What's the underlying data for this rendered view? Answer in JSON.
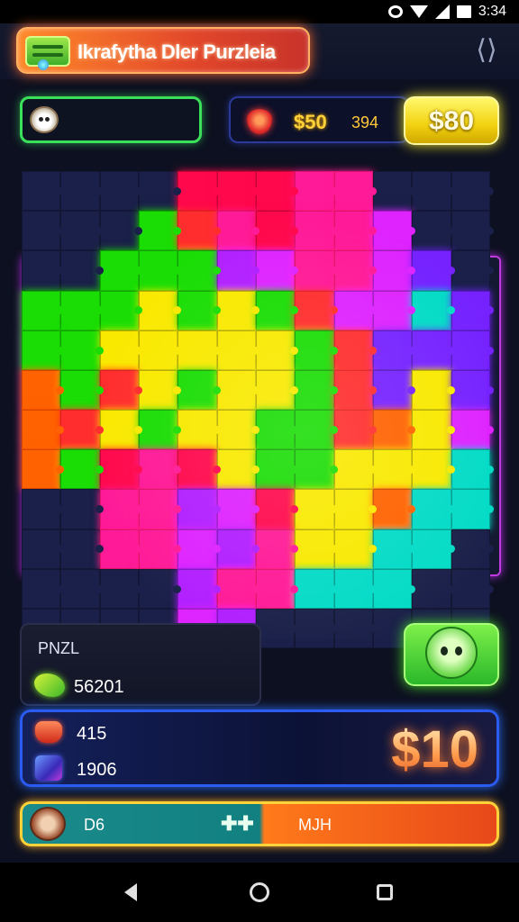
{
  "status_bar": {
    "time": "3:34"
  },
  "header": {
    "title": "Ikrafytha Dler Purzleia",
    "exit_icon": "exit-icon"
  },
  "top_hud": {
    "score_main": "$50",
    "score_sub": "394",
    "coin_button_label": "$80"
  },
  "stats": {
    "label": "PNZL",
    "value": "56201"
  },
  "reward": {
    "ruby_value": "415",
    "cube_value": "1906",
    "price": "$10"
  },
  "bottom_bar": {
    "left_label": "D6",
    "right_label": "MJH"
  },
  "colors": {
    "accent_green": "#3ae05a",
    "accent_orange": "#ff7a1a",
    "accent_blue": "#2b5bf0",
    "accent_yellow": "#ffd23a",
    "board_border": "#c03adf"
  },
  "board": {
    "rows": 12,
    "cols": 12,
    "palette": [
      "#2a1a4a",
      "#1c2040",
      "#e0164a",
      "#ff2a8a",
      "#3ad02a",
      "#f2e62a",
      "#ff6a1a",
      "#9a2ae0",
      "#c030e0",
      "#2ad0c0",
      "#6a2ad8",
      "#ff3a3a"
    ],
    "cells": [
      [
        1,
        1,
        1,
        1,
        2,
        2,
        2,
        3,
        3,
        1,
        1,
        1
      ],
      [
        1,
        1,
        1,
        4,
        11,
        3,
        2,
        3,
        3,
        8,
        1,
        1
      ],
      [
        1,
        1,
        4,
        4,
        4,
        7,
        8,
        3,
        3,
        8,
        10,
        1
      ],
      [
        4,
        4,
        4,
        5,
        4,
        5,
        4,
        11,
        8,
        8,
        9,
        10
      ],
      [
        4,
        4,
        5,
        5,
        5,
        5,
        5,
        4,
        11,
        10,
        10,
        10
      ],
      [
        6,
        4,
        11,
        5,
        4,
        5,
        5,
        4,
        11,
        10,
        5,
        10
      ],
      [
        6,
        11,
        5,
        4,
        5,
        5,
        4,
        4,
        11,
        6,
        5,
        8
      ],
      [
        6,
        4,
        2,
        3,
        2,
        5,
        4,
        4,
        5,
        5,
        5,
        9
      ],
      [
        1,
        1,
        3,
        3,
        7,
        8,
        2,
        5,
        5,
        6,
        9,
        9
      ],
      [
        1,
        1,
        3,
        3,
        8,
        7,
        3,
        5,
        5,
        9,
        9,
        1
      ],
      [
        1,
        1,
        1,
        1,
        7,
        3,
        3,
        9,
        9,
        9,
        1,
        1
      ],
      [
        1,
        1,
        1,
        1,
        8,
        7,
        1,
        1,
        1,
        1,
        1,
        1
      ]
    ]
  }
}
